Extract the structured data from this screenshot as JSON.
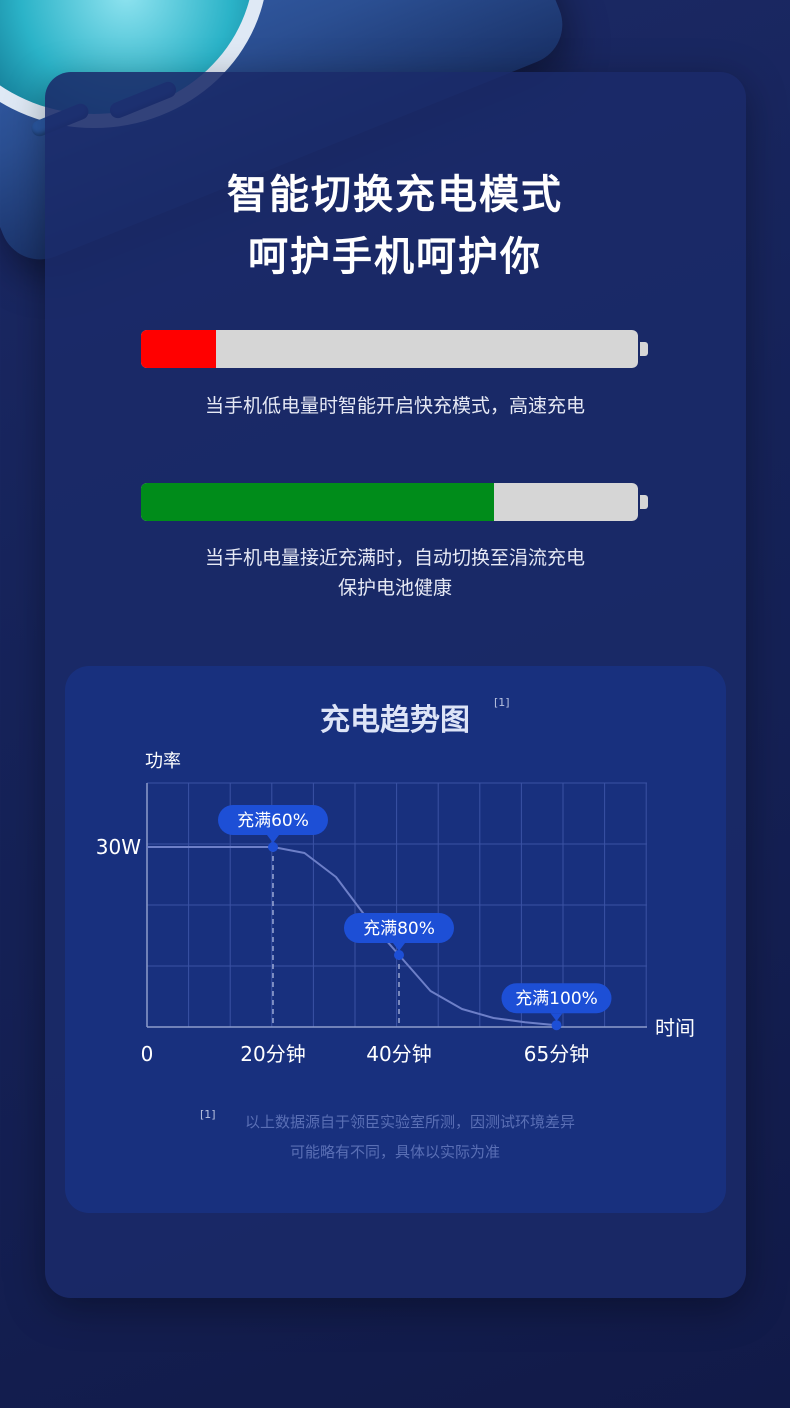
{
  "header": {
    "title_line1": "智能切换充电模式",
    "title_line2": "呵护手机呵护你"
  },
  "battery_low": {
    "level": 0.15,
    "fill_color": "#ff0000",
    "caption": "当手机低电量时智能开启快充模式，高速充电"
  },
  "battery_high": {
    "level": 0.71,
    "fill_color": "#008c1a",
    "caption_line1": "当手机电量接近充满时，自动切换至涓流充电",
    "caption_line2": "保护电池健康"
  },
  "chart_card": {
    "title": "充电趋势图",
    "footnote_mark": "[1]",
    "note_mark": "[1]",
    "note_line1": "以上数据源自于领臣实验室所测，因测试环境差异",
    "note_line2": "可能略有不同，具体以实际为准"
  },
  "chart_data": {
    "type": "line",
    "ylabel": "功率",
    "xlabel": "时间",
    "y_tick": "30W",
    "x_ticks": [
      "0",
      "20分钟",
      "40分钟",
      "65分钟"
    ],
    "x": [
      0,
      5,
      10,
      15,
      20,
      25,
      30,
      35,
      40,
      45,
      50,
      55,
      60,
      65
    ],
    "y": [
      30,
      30,
      30,
      30,
      30,
      29,
      25,
      18,
      12,
      6,
      3,
      1.5,
      0.8,
      0.3
    ],
    "xlim": [
      0,
      75
    ],
    "ylim": [
      0,
      40
    ],
    "annotations": [
      {
        "label": "充满60%",
        "x": 20,
        "y": 30
      },
      {
        "label": "充满80%",
        "x": 40,
        "y": 12
      },
      {
        "label": "充满100%",
        "x": 65,
        "y": 0.3
      }
    ],
    "line_color": "#6d7fc8",
    "marker_color": "#1d4fd6",
    "grid": true
  }
}
